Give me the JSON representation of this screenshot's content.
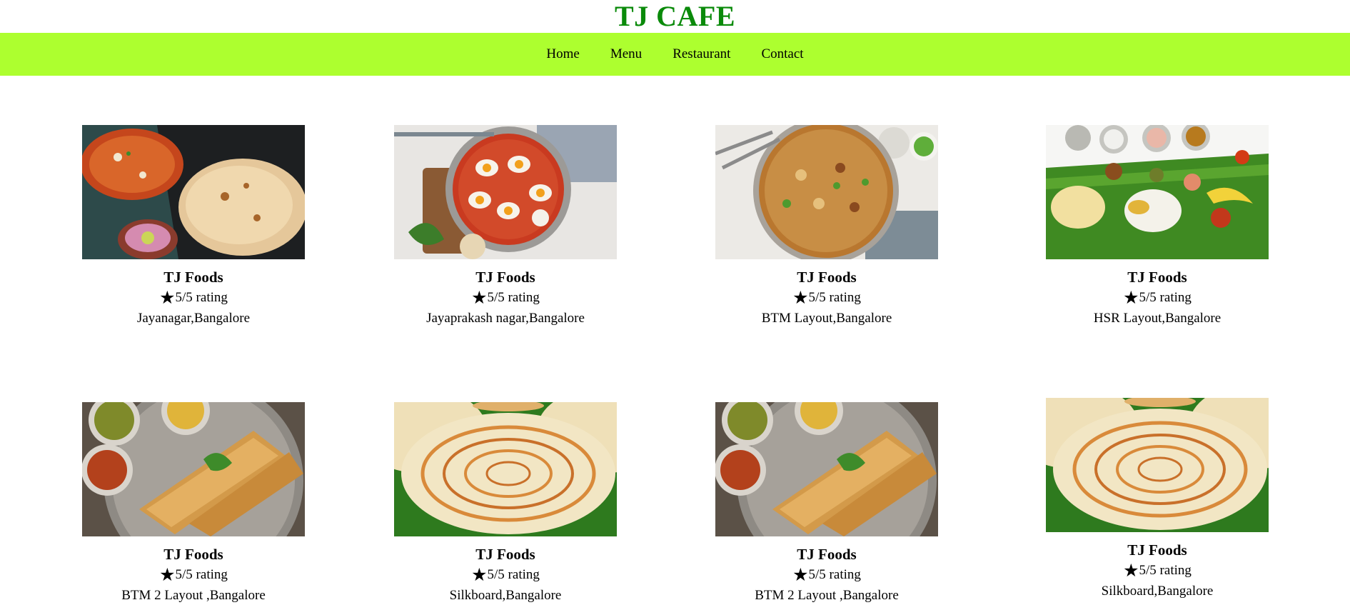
{
  "header": {
    "title": "TJ CAFE"
  },
  "nav": {
    "items": [
      "Home",
      "Menu",
      "Restaurant",
      "Contact"
    ]
  },
  "colors": {
    "title": "#0a8a0a",
    "nav_bg": "#adff2f"
  },
  "cards": [
    {
      "image": "butter-chicken-naan-image",
      "title": "TJ Foods",
      "rating": "5/5 rating",
      "location": "Jayanagar,Bangalore"
    },
    {
      "image": "egg-curry-pan-image",
      "title": "TJ Foods",
      "rating": "5/5 rating",
      "location": "Jayaprakash nagar,Bangalore"
    },
    {
      "image": "biryani-plate-image",
      "title": "TJ Foods",
      "rating": "5/5 rating",
      "location": "BTM Layout,Bangalore"
    },
    {
      "image": "banana-leaf-meals-image",
      "title": "TJ Foods",
      "rating": "5/5 rating",
      "location": "HSR Layout,Bangalore"
    },
    {
      "image": "masala-dosa-image",
      "title": "TJ Foods",
      "rating": "5/5 rating",
      "location": "BTM 2 Layout ,Bangalore"
    },
    {
      "image": "paratha-image",
      "title": "TJ Foods",
      "rating": "5/5 rating",
      "location": "Silkboard,Bangalore"
    },
    {
      "image": "masala-dosa-image",
      "title": "TJ Foods",
      "rating": "5/5 rating",
      "location": "BTM 2 Layout ,Bangalore"
    },
    {
      "image": "paratha-image",
      "title": "TJ Foods",
      "rating": "5/5 rating",
      "location": "Silkboard,Bangalore"
    }
  ]
}
